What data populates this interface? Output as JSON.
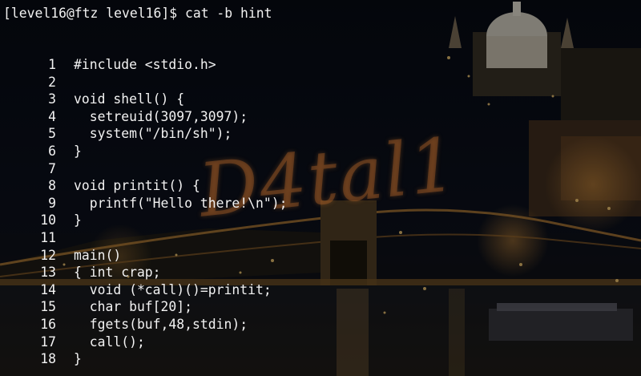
{
  "wallpaper": {
    "scene": "night-city-bridge-photo",
    "watermark_text": "D4tal1"
  },
  "terminal": {
    "prompt": "[level16@ftz level16]$ cat -b hint",
    "lines": [
      {
        "num": "1",
        "code": "#include <stdio.h>"
      },
      {
        "num": "2",
        "code": ""
      },
      {
        "num": "3",
        "code": "void shell() {"
      },
      {
        "num": "4",
        "code": "  setreuid(3097,3097);"
      },
      {
        "num": "5",
        "code": "  system(\"/bin/sh\");"
      },
      {
        "num": "6",
        "code": "}"
      },
      {
        "num": "7",
        "code": ""
      },
      {
        "num": "8",
        "code": "void printit() {"
      },
      {
        "num": "9",
        "code": "  printf(\"Hello there!\\n\");"
      },
      {
        "num": "10",
        "code": "}"
      },
      {
        "num": "11",
        "code": ""
      },
      {
        "num": "12",
        "code": "main()"
      },
      {
        "num": "13",
        "code": "{ int crap;"
      },
      {
        "num": "14",
        "code": "  void (*call)()=printit;"
      },
      {
        "num": "15",
        "code": "  char buf[20];"
      },
      {
        "num": "16",
        "code": "  fgets(buf,48,stdin);"
      },
      {
        "num": "17",
        "code": "  call();"
      },
      {
        "num": "18",
        "code": "}"
      }
    ]
  }
}
